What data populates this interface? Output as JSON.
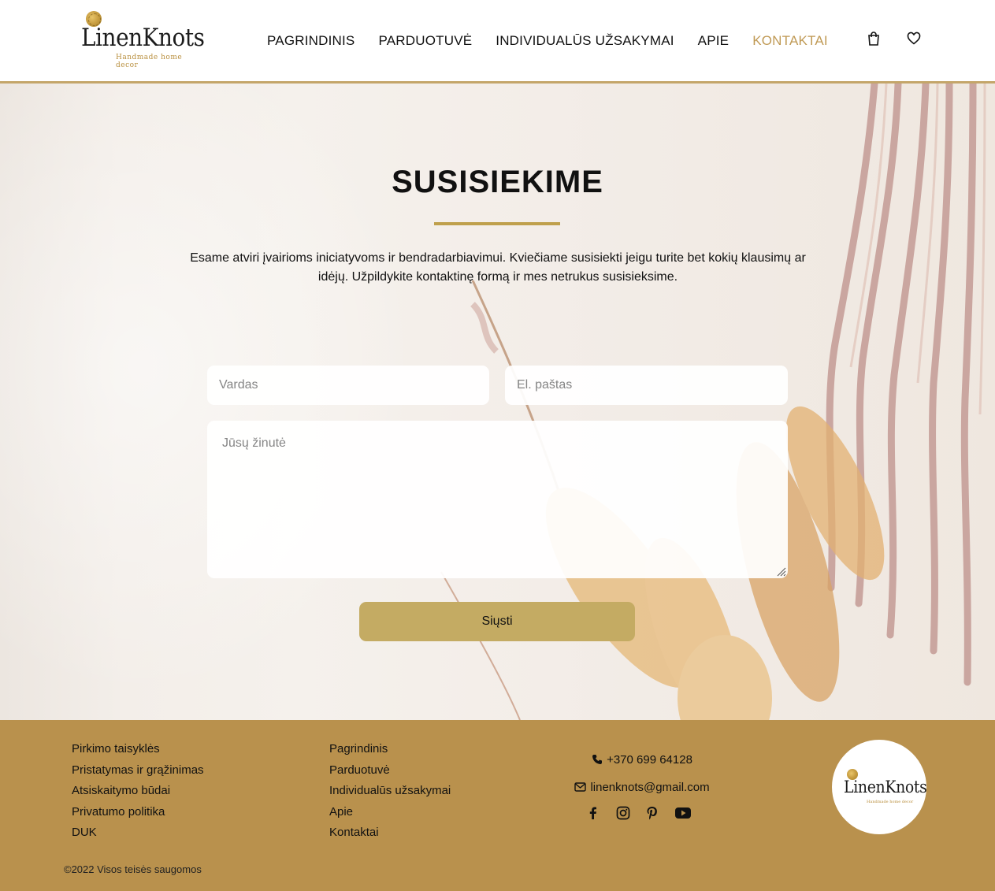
{
  "header": {
    "logo_text": "LinenKnots",
    "logo_tagline": "Handmade home decor",
    "nav": [
      {
        "label": "PAGRINDINIS"
      },
      {
        "label": "PARDUOTUVĖ"
      },
      {
        "label": "INDIVIDUALŪS UŽSAKYMAI"
      },
      {
        "label": "APIE"
      },
      {
        "label": "KONTAKTAI",
        "active": true
      }
    ],
    "icons": [
      "shopping-bag-icon",
      "heart-icon"
    ]
  },
  "hero": {
    "title": "SUSISIEKIME",
    "intro": "Esame atviri įvairioms iniciatyvoms ir bendradarbiavimui. Kviečiame susisiekti jeigu turite bet kokių klausimų ar idėjų. Užpildykite kontaktinę formą ir mes netrukus susisieksime."
  },
  "form": {
    "name_placeholder": "Vardas",
    "email_placeholder": "El. paštas",
    "message_placeholder": "Jūsų žinutė",
    "submit_label": "Siųsti"
  },
  "footer": {
    "col1": [
      "Pirkimo taisyklės",
      "Pristatymas ir grąžinimas",
      "Atsiskaitymo būdai",
      "Privatumo politika",
      "DUK"
    ],
    "col2": [
      "Pagrindinis",
      "Parduotuvė",
      "Individualūs užsakymai",
      "Apie",
      "Kontaktai"
    ],
    "phone": "+370 699 64128",
    "email": "linenknots@gmail.com",
    "socials": [
      "facebook-icon",
      "instagram-icon",
      "pinterest-icon",
      "youtube-icon"
    ],
    "logo_text": "LinenKnots",
    "copyright": "©2022 Visos teisės saugomos"
  },
  "colors": {
    "accent": "#c09a55",
    "divider": "#bfa04c",
    "button": "#c4ab63",
    "footer_bg": "#b9914d"
  }
}
